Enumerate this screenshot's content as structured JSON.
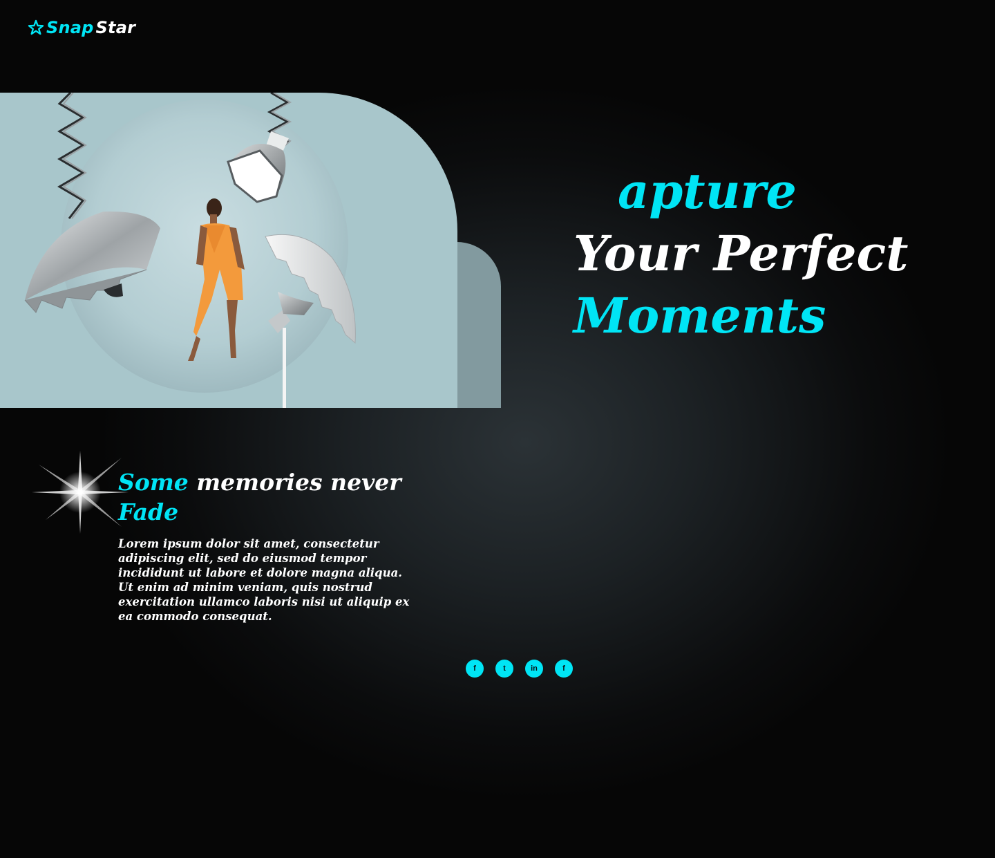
{
  "brand": {
    "name_part1": "Snap",
    "name_part2": "Star",
    "logo_icon": "star-icon"
  },
  "hero": {
    "headline_line1": "apture",
    "headline_line2": "Your Perfect",
    "headline_line3": "Moments",
    "image_desc_icon": "studio-photo-illustration"
  },
  "section": {
    "title_accent": "Some",
    "title_main": "memories never",
    "title_end": "Fade",
    "body": "Lorem ipsum dolor sit amet, consectetur adipiscing elit, sed do eiusmod tempor incididunt ut labore et dolore magna aliqua. Ut enim ad minim veniam, quis nostrud exercitation ullamco laboris nisi ut aliquip ex ea commodo consequat."
  },
  "socials": [
    {
      "name": "facebook",
      "glyph": "f"
    },
    {
      "name": "twitter",
      "glyph": "t"
    },
    {
      "name": "linkedin",
      "glyph": "in"
    },
    {
      "name": "facebook",
      "glyph": "f"
    }
  ],
  "colors": {
    "accent": "#00e5f5",
    "background": "#060606",
    "hero_bg": "#a8c6cb",
    "hero_back": "#829a9f"
  }
}
